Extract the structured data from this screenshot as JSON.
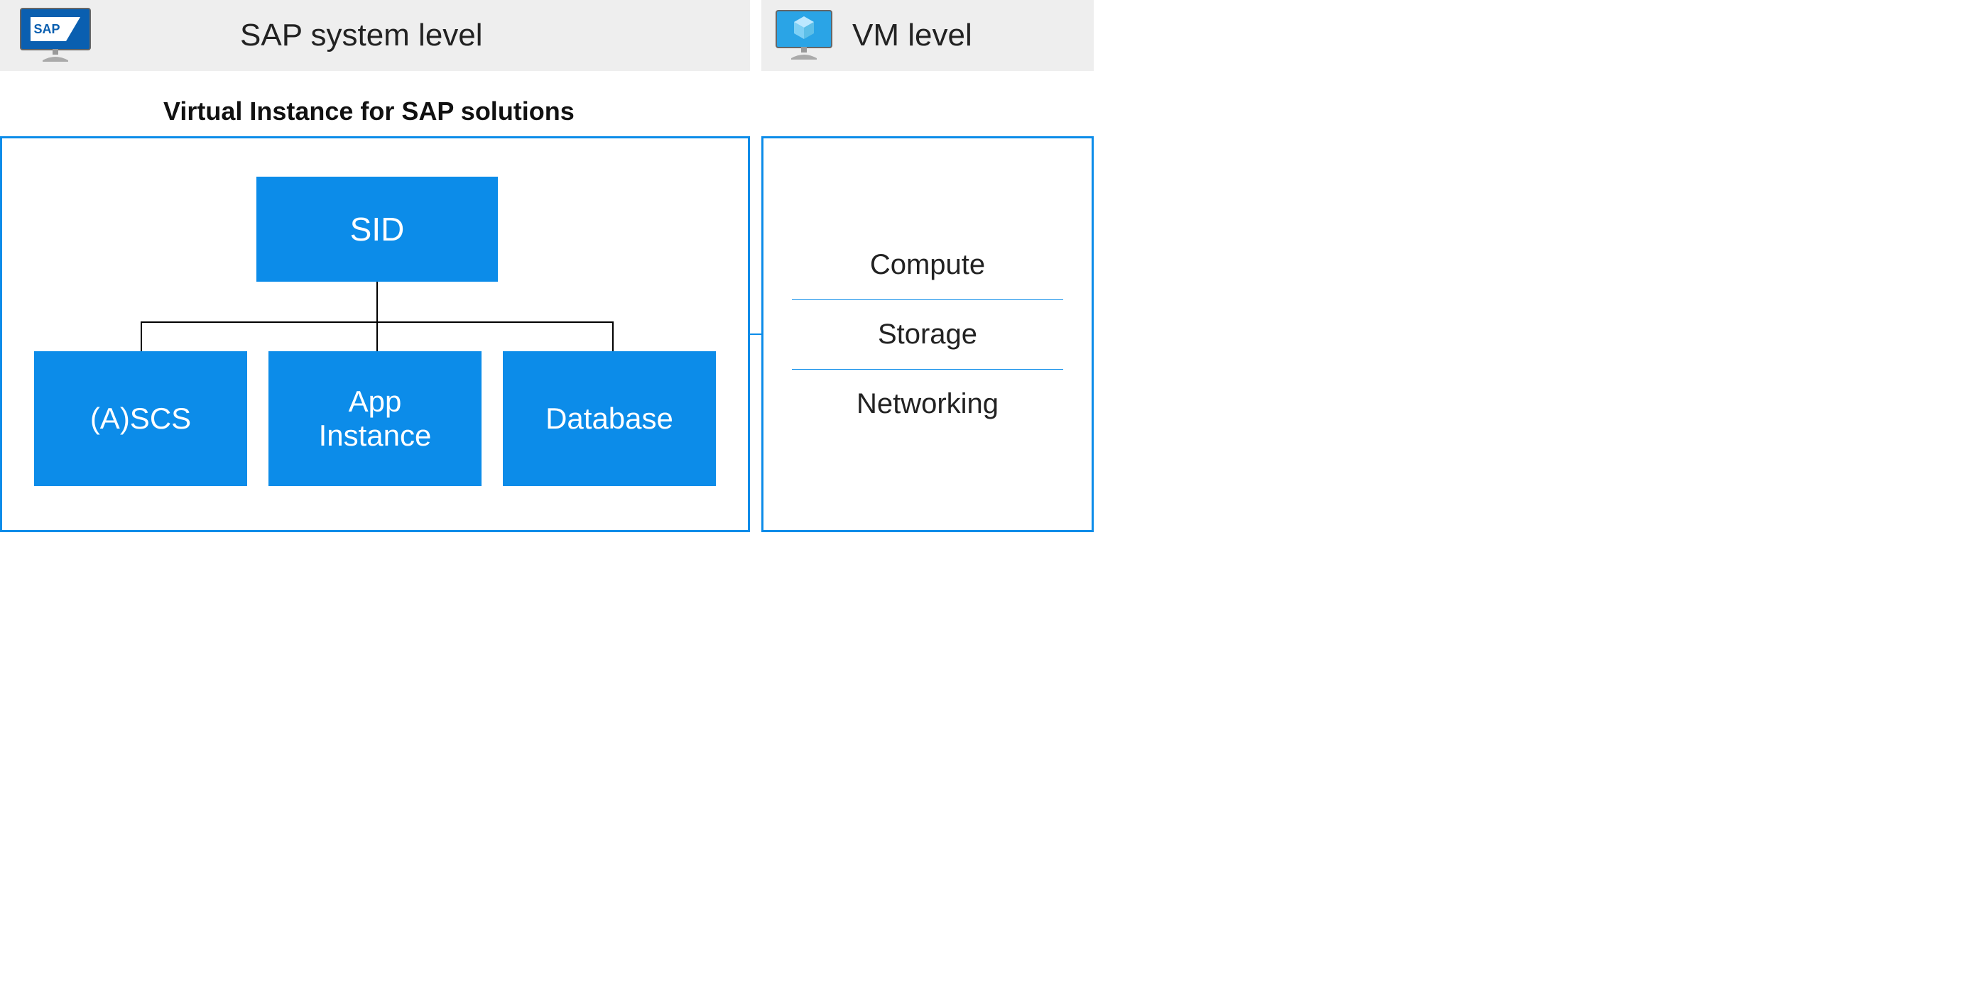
{
  "header": {
    "left_title": "SAP system level",
    "right_title": "VM level",
    "sap_logo_text": "SAP"
  },
  "subtitle": "Virtual Instance for SAP solutions",
  "colors": {
    "azure_blue": "#0c8ce9",
    "header_bg": "#eeeeee",
    "sap_blue": "#0a5fb0",
    "vm_blue": "#2aa4e6"
  },
  "sap_tree": {
    "root": "SID",
    "children": [
      "(A)SCS",
      "App\nInstance",
      "Database"
    ]
  },
  "vm_stack": [
    "Compute",
    "Storage",
    "Networking"
  ]
}
